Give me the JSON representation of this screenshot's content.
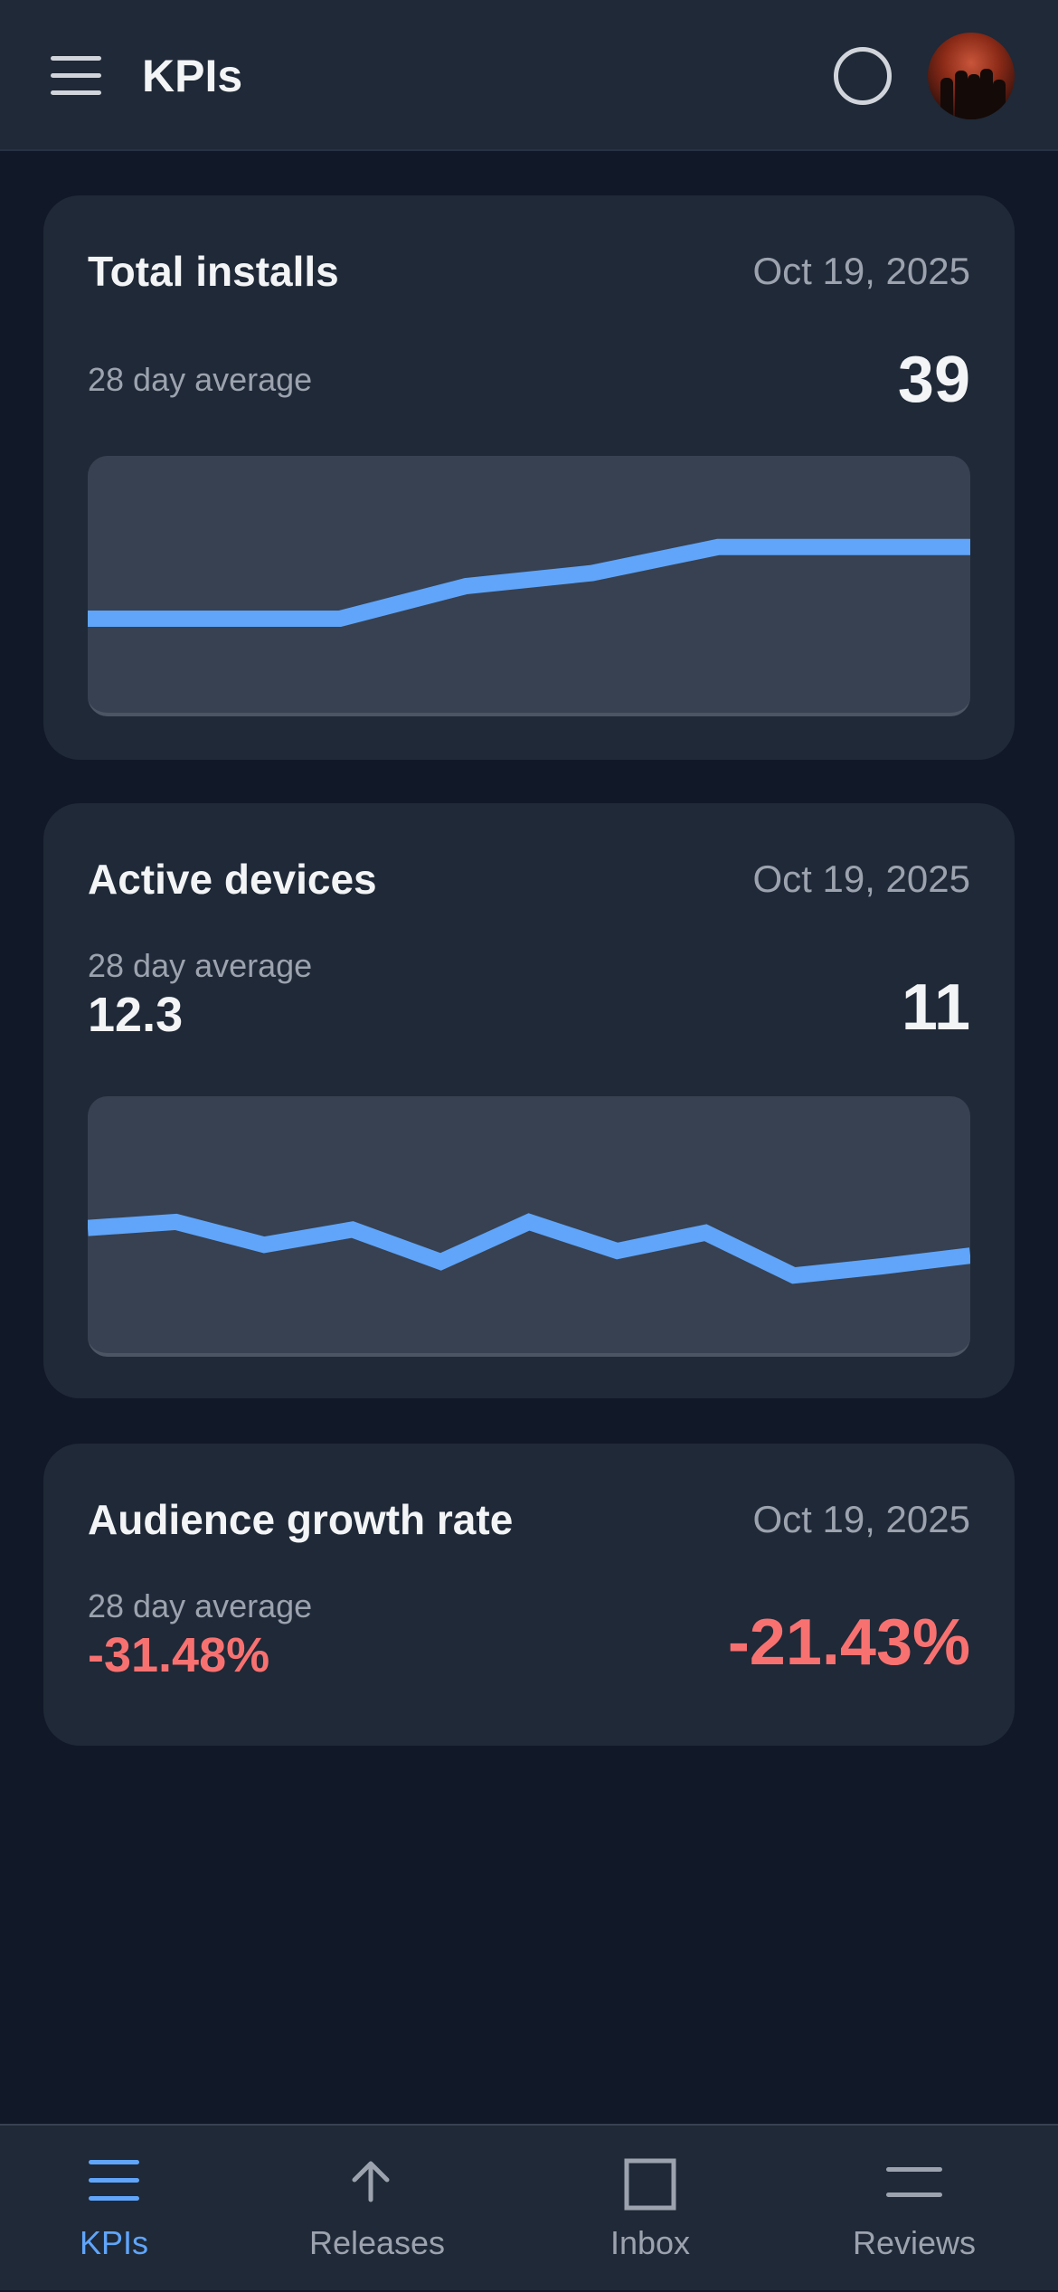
{
  "header": {
    "title": "KPIs"
  },
  "cards": [
    {
      "title": "Total installs",
      "date": "Oct 19, 2025",
      "subtitle": "28 day average",
      "value": "39"
    },
    {
      "title": "Active devices",
      "date": "Oct 19, 2025",
      "subtitle": "28 day average",
      "average": "12.3",
      "value": "11"
    },
    {
      "title": "Audience growth rate",
      "date": "Oct 19, 2025",
      "subtitle": "28 day average",
      "average": "-31.48%",
      "value": "-21.43%"
    }
  ],
  "chart_data": [
    {
      "type": "line",
      "series": [
        {
          "values": [
            41,
            41,
            41,
            42,
            42.4,
            43.2,
            43.2,
            43.2
          ]
        }
      ],
      "ylim": [
        38,
        46
      ],
      "color": "#60a5fa"
    },
    {
      "type": "line",
      "series": [
        {
          "values": [
            13.4,
            13.8,
            12.3,
            13.3,
            11.2,
            13.8,
            11.9,
            13.1,
            10.3,
            10.9,
            11.6
          ]
        }
      ],
      "ylim": [
        5,
        22
      ],
      "color": "#60a5fa"
    }
  ],
  "colors": {
    "accent": "#60a5fa",
    "negative": "#f87171",
    "background": "#111827",
    "card": "#1f2937"
  },
  "bottom_nav": {
    "items": [
      {
        "label": "KPIs",
        "icon": "list-icon",
        "active": true
      },
      {
        "label": "Releases",
        "icon": "arrow-up-icon",
        "active": false
      },
      {
        "label": "Inbox",
        "icon": "inbox-icon",
        "active": false
      },
      {
        "label": "Reviews",
        "icon": "reviews-icon",
        "active": false
      }
    ]
  }
}
